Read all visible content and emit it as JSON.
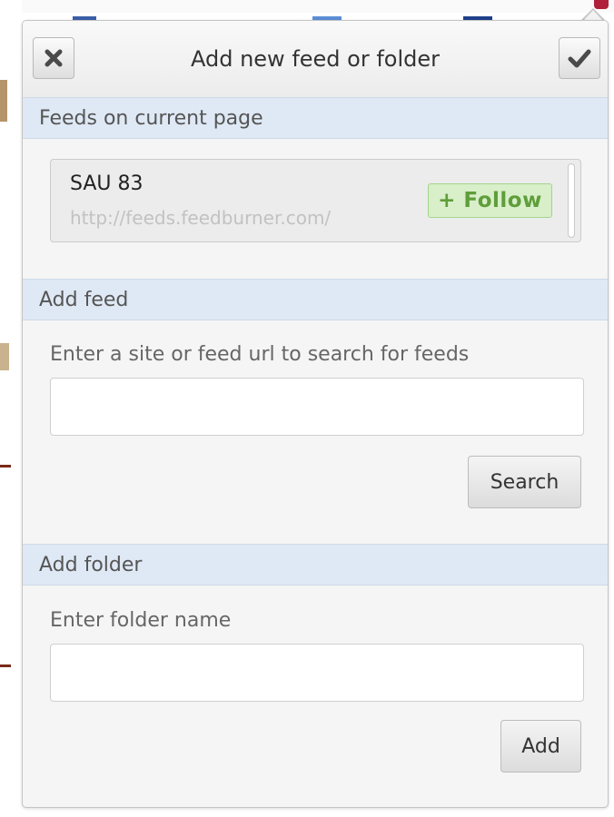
{
  "header": {
    "title": "Add new feed or folder",
    "close_icon": "close-x-icon",
    "confirm_icon": "checkmark-icon"
  },
  "current_page": {
    "section_title": "Feeds on current page",
    "feeds": [
      {
        "title": "SAU 83",
        "url": "http://feeds.feedburner.com/",
        "follow_label": "+ Follow"
      }
    ]
  },
  "add_feed": {
    "section_title": "Add feed",
    "label": "Enter a site or feed url to search for feeds",
    "value": "",
    "button_label": "Search"
  },
  "add_folder": {
    "section_title": "Add folder",
    "label": "Enter folder name",
    "value": "",
    "button_label": "Add"
  },
  "colors": {
    "section_bar": "#dfe9f5",
    "follow_green": "#5f9e3a",
    "follow_bg": "#d8efc9"
  }
}
